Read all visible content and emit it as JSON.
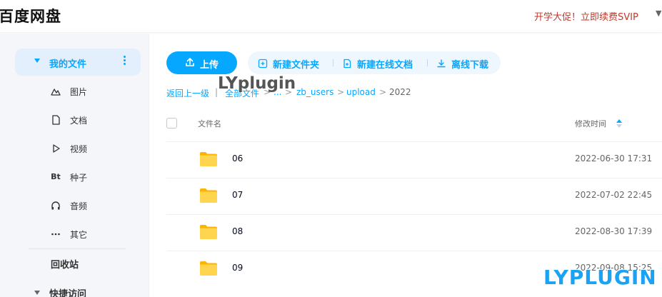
{
  "app": {
    "logo": "百度网盘",
    "promo": "开学大促！立即续费SVIP"
  },
  "sidebar": {
    "main": "我的文件",
    "categories": [
      {
        "label": "图片",
        "icon": "image-icon"
      },
      {
        "label": "文档",
        "icon": "document-icon"
      },
      {
        "label": "视频",
        "icon": "video-icon"
      },
      {
        "label": "种子",
        "icon": "torrent-icon",
        "glyph": "Bt"
      },
      {
        "label": "音频",
        "icon": "headphone-icon"
      },
      {
        "label": "其它",
        "icon": "more-icon"
      }
    ],
    "recycle": "回收站",
    "quick": "快捷访问"
  },
  "toolbar": {
    "upload": "上传",
    "new_folder": "新建文件夹",
    "new_doc": "新建在线文档",
    "offline": "离线下载"
  },
  "watermark_top": "LYplugin",
  "watermark_bottom": "LYPLUGIN",
  "breadcrumb": {
    "back": "返回上一级",
    "divider": "|",
    "all": "全部文件",
    "ellipsis": "...",
    "zb": "zb_users",
    "upload": "upload",
    "current": "2022",
    "sep": ">"
  },
  "table": {
    "col_name": "文件名",
    "col_time": "修改时间",
    "rows": [
      {
        "name": "06",
        "time": "2022-06-30 17:31"
      },
      {
        "name": "07",
        "time": "2022-07-02 22:45"
      },
      {
        "name": "08",
        "time": "2022-08-30 17:39"
      },
      {
        "name": "09",
        "time": "2022-09-08 15:25"
      }
    ]
  },
  "colors": {
    "accent": "#06a7ff",
    "promo": "#c0392b",
    "folder": "#ffc933"
  }
}
